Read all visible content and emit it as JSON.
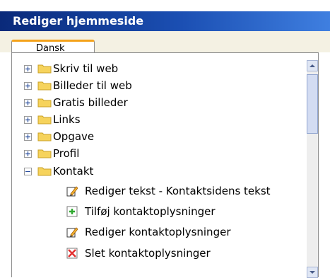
{
  "panel": {
    "title": "Rediger hjemmeside"
  },
  "tabs": [
    {
      "label": "Dansk"
    }
  ],
  "tree": [
    {
      "label": "Skriv til web",
      "expanded": false
    },
    {
      "label": "Billeder til web",
      "expanded": false
    },
    {
      "label": "Gratis billeder",
      "expanded": false
    },
    {
      "label": "Links",
      "expanded": false
    },
    {
      "label": "Opgave",
      "expanded": false
    },
    {
      "label": "Profil",
      "expanded": false
    },
    {
      "label": "Kontakt",
      "expanded": true,
      "children": [
        {
          "label": "Rediger tekst - Kontaktsidens tekst",
          "icon": "pencil-edit-icon"
        },
        {
          "label": "Tilføj kontaktoplysninger",
          "icon": "add-plus-icon"
        },
        {
          "label": "Rediger kontaktoplysninger",
          "icon": "pencil-edit-icon"
        },
        {
          "label": "Slet kontaktoplysninger",
          "icon": "delete-x-icon"
        }
      ]
    }
  ],
  "colors": {
    "title_bar": "#1b4fb3",
    "tab_accent": "#f4a21a",
    "folder": "#f6d35c",
    "add": "#2fa92f",
    "delete": "#e23030"
  }
}
